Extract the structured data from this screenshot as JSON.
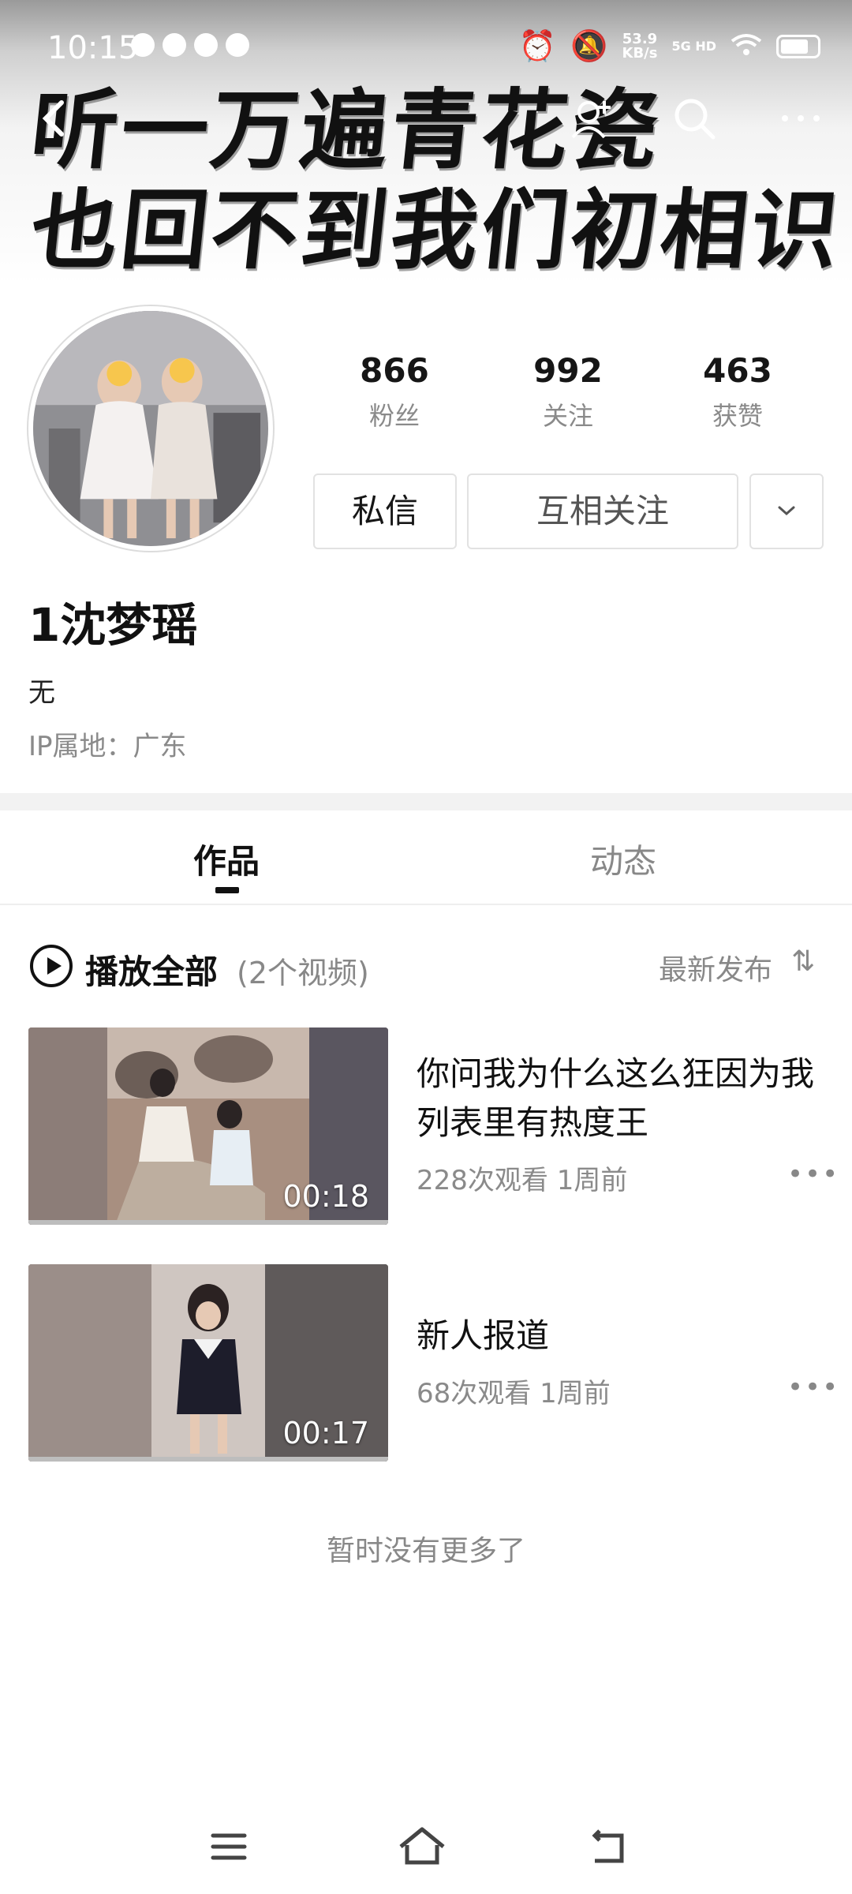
{
  "status_bar": {
    "time": "10:15",
    "net_speed_value": "53.9",
    "net_speed_unit": "KB/s",
    "network": "5G HD"
  },
  "banner": {
    "line1": "听一万遍青花瓷",
    "line2": "也回不到我们初相识"
  },
  "nav": {
    "back_icon": "chevron-left-icon",
    "share_icon": "user-share-icon",
    "search_icon": "search-icon",
    "more_icon": "more-horizontal-icon"
  },
  "profile": {
    "fans_count": "866",
    "fans_label": "粉丝",
    "following_count": "992",
    "following_label": "关注",
    "likes_count": "463",
    "likes_label": "获赞",
    "message_button": "私信",
    "mutual_button": "互相关注",
    "username": "1沈梦瑶",
    "bio": "无",
    "ip_location": "IP属地：广东"
  },
  "tabs": {
    "works": "作品",
    "dynamic": "动态"
  },
  "playlist": {
    "play_all": "播放全部",
    "count": "(2个视频)",
    "sort": "最新发布"
  },
  "videos": [
    {
      "title": "你问我为什么这么狂因为我列表里有热度王",
      "views": "228次观看",
      "time": "1周前",
      "duration": "00:18"
    },
    {
      "title": "新人报道",
      "views": "68次观看",
      "time": "1周前",
      "duration": "00:17"
    }
  ],
  "end_text": "暂时没有更多了"
}
